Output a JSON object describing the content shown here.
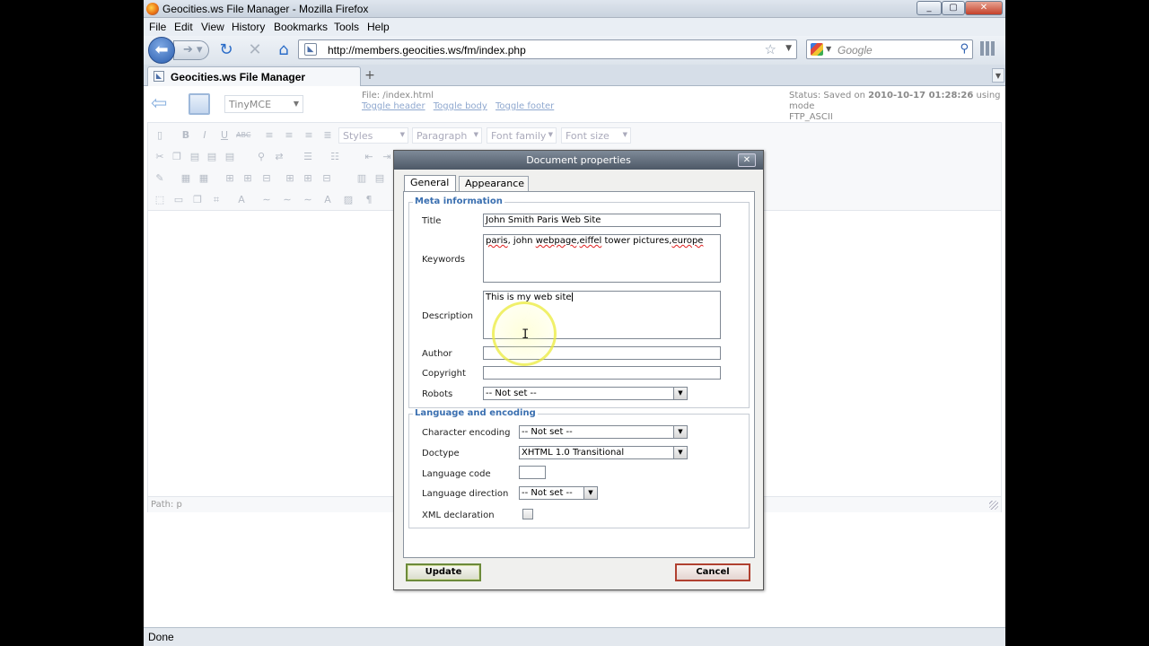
{
  "window": {
    "title": "Geocities.ws File Manager - Mozilla Firefox",
    "controls": [
      "_",
      "▢",
      "✕"
    ]
  },
  "menu": [
    "File",
    "Edit",
    "View",
    "History",
    "Bookmarks",
    "Tools",
    "Help"
  ],
  "nav": {
    "url": "http://members.geocities.ws/fm/index.php",
    "search_placeholder": "Google"
  },
  "tabs": [
    {
      "label": "Geocities.ws File Manager"
    }
  ],
  "filemanager": {
    "editor_select": "TinyMCE",
    "file_label": "File: /index.html",
    "links": [
      "Toggle header",
      "Toggle body",
      "Toggle footer"
    ],
    "status_prefix": "Status: Saved on ",
    "status_date": "2010-10-17 01:28:26",
    "status_suffix": " using mode",
    "status_mode": "FTP_ASCII"
  },
  "editor": {
    "styles": "Styles",
    "paragraph": "Paragraph",
    "font_family": "Font family",
    "font_size": "Font size",
    "path": "Path: p"
  },
  "dialog": {
    "title": "Document properties",
    "tabs": [
      "General",
      "Appearance"
    ],
    "meta": {
      "legend": "Meta information",
      "title_label": "Title",
      "title_value": "John Smith Paris Web Site",
      "keywords_label": "Keywords",
      "keywords_words": [
        "paris",
        ", john ",
        "webpage",
        ",",
        "eiffel",
        " tower pictures,",
        "europe"
      ],
      "description_label": "Description",
      "description_value": "This is my web site",
      "author_label": "Author",
      "author_value": "",
      "copyright_label": "Copyright",
      "copyright_value": "",
      "robots_label": "Robots",
      "robots_value": "-- Not set --"
    },
    "lang": {
      "legend": "Language and encoding",
      "charset_label": "Character encoding",
      "charset_value": "-- Not set --",
      "doctype_label": "Doctype",
      "doctype_value": "XHTML 1.0 Transitional",
      "langcode_label": "Language code",
      "langcode_value": "",
      "langdir_label": "Language direction",
      "langdir_value": "-- Not set --",
      "xmldecl_label": "XML declaration"
    },
    "update_label": "Update",
    "cancel_label": "Cancel"
  },
  "statusbar": "Done",
  "colors": {
    "legend": "#3a6fb0",
    "update_border": "#6c8a3a",
    "cancel_border": "#b04030"
  }
}
